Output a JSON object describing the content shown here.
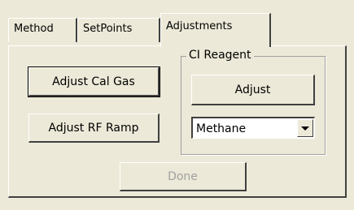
{
  "tabs": [
    {
      "label": "Method",
      "active": false
    },
    {
      "label": "SetPoints",
      "active": false
    },
    {
      "label": "Adjustments",
      "active": true
    }
  ],
  "buttons": {
    "adjust_cal_gas": "Adjust Cal Gas",
    "adjust_rf_ramp": "Adjust RF Ramp",
    "done": "Done"
  },
  "ci_reagent": {
    "legend": "CI Reagent",
    "adjust_label": "Adjust",
    "selected_reagent": "Methane"
  },
  "icons": {
    "dropdown": "chevron-down-icon"
  },
  "colors": {
    "face": "#ece9d8",
    "disabled_text": "#a0a0a0"
  }
}
